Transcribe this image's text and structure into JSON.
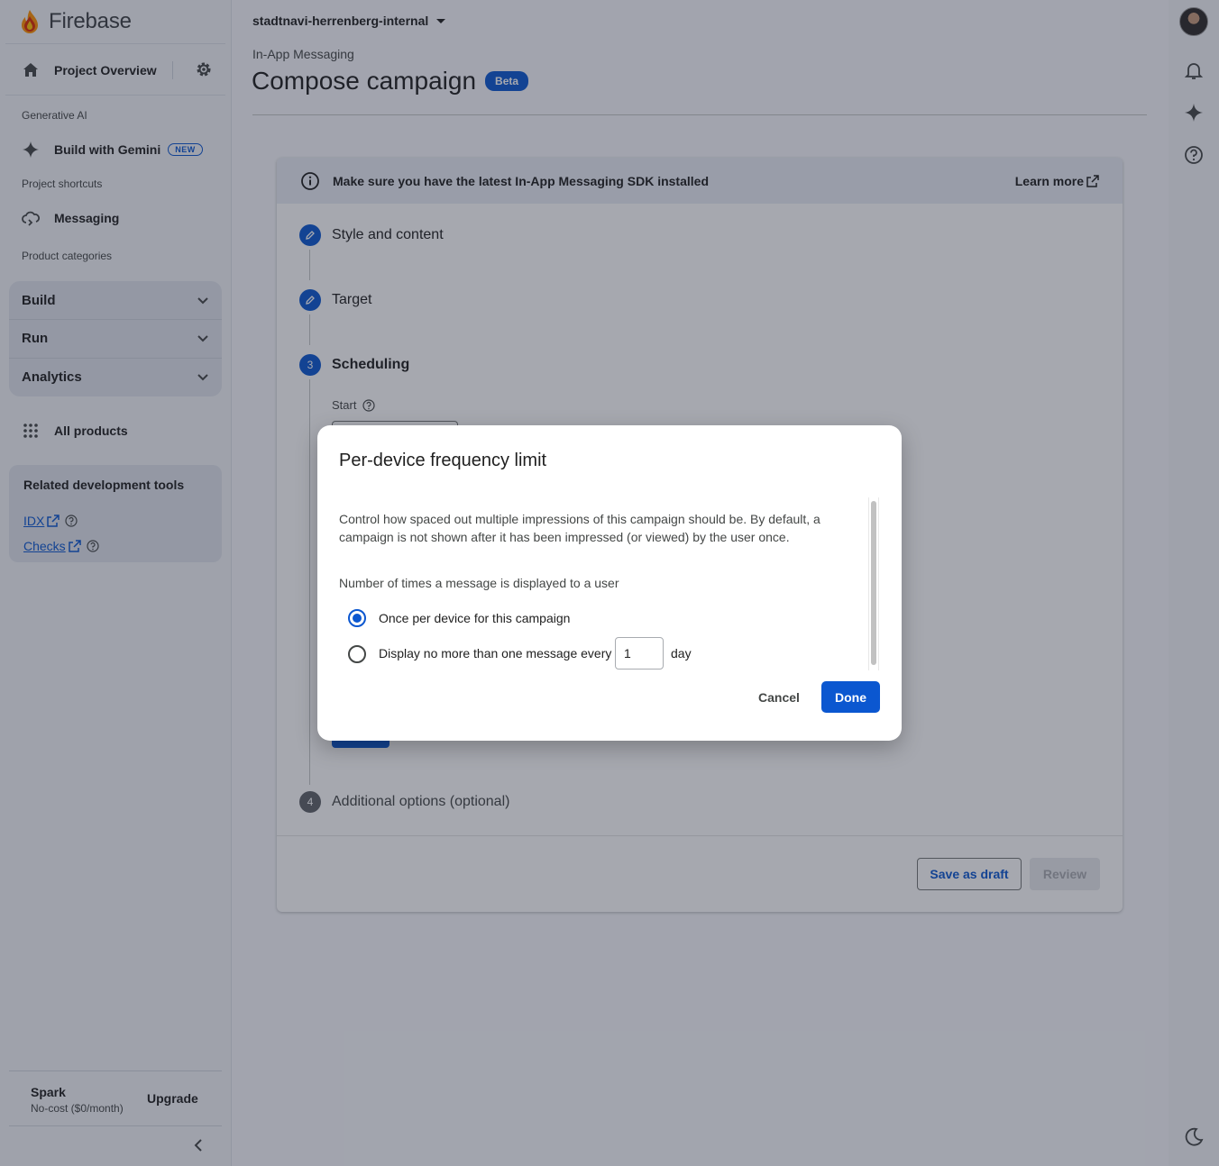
{
  "sidebar": {
    "brand": "Firebase",
    "project_overview": "Project Overview",
    "sections": {
      "generative_ai": "Generative AI",
      "project_shortcuts": "Project shortcuts",
      "product_categories": "Product categories"
    },
    "gemini": {
      "label": "Build with Gemini",
      "badge": "NEW"
    },
    "messaging": "Messaging",
    "categories": [
      {
        "label": "Build"
      },
      {
        "label": "Run"
      },
      {
        "label": "Analytics"
      }
    ],
    "all_products": "All products",
    "tools": {
      "title": "Related development tools",
      "links": [
        {
          "label": "IDX"
        },
        {
          "label": "Checks"
        }
      ]
    },
    "plan": {
      "name": "Spark",
      "cost": "No-cost ($0/month)",
      "upgrade": "Upgrade"
    }
  },
  "header": {
    "project": "stadtnavi-herrenberg-internal",
    "breadcrumb": "In-App Messaging",
    "title": "Compose campaign",
    "badge": "Beta"
  },
  "card": {
    "banner": {
      "text": "Make sure you have the latest In-App Messaging SDK installed",
      "link": "Learn more"
    },
    "steps": [
      {
        "number": "",
        "label": "Style and content",
        "state": "edited"
      },
      {
        "number": "",
        "label": "Target",
        "state": "edited"
      },
      {
        "number": "3",
        "label": "Scheduling",
        "state": "active"
      },
      {
        "number": "4",
        "label": "Additional options (optional)",
        "state": "pending"
      }
    ],
    "start_label": "Start",
    "buttons": {
      "save_draft": "Save as draft",
      "review": "Review"
    }
  },
  "dialog": {
    "title": "Per-device frequency limit",
    "description": "Control how spaced out multiple impressions of this campaign should be. By default, a campaign is not shown after it has been impressed (or viewed) by the user once.",
    "question": "Number of times a message is displayed to a user",
    "options": [
      {
        "label": "Once per device for this campaign",
        "selected": true
      },
      {
        "label": "Display no more than one message every",
        "selected": false
      }
    ],
    "interval_value": "1",
    "interval_unit": "day",
    "cancel": "Cancel",
    "done": "Done"
  },
  "colors": {
    "accent": "#0b57d0",
    "scrim": "rgba(32,38,56,0.40)"
  }
}
